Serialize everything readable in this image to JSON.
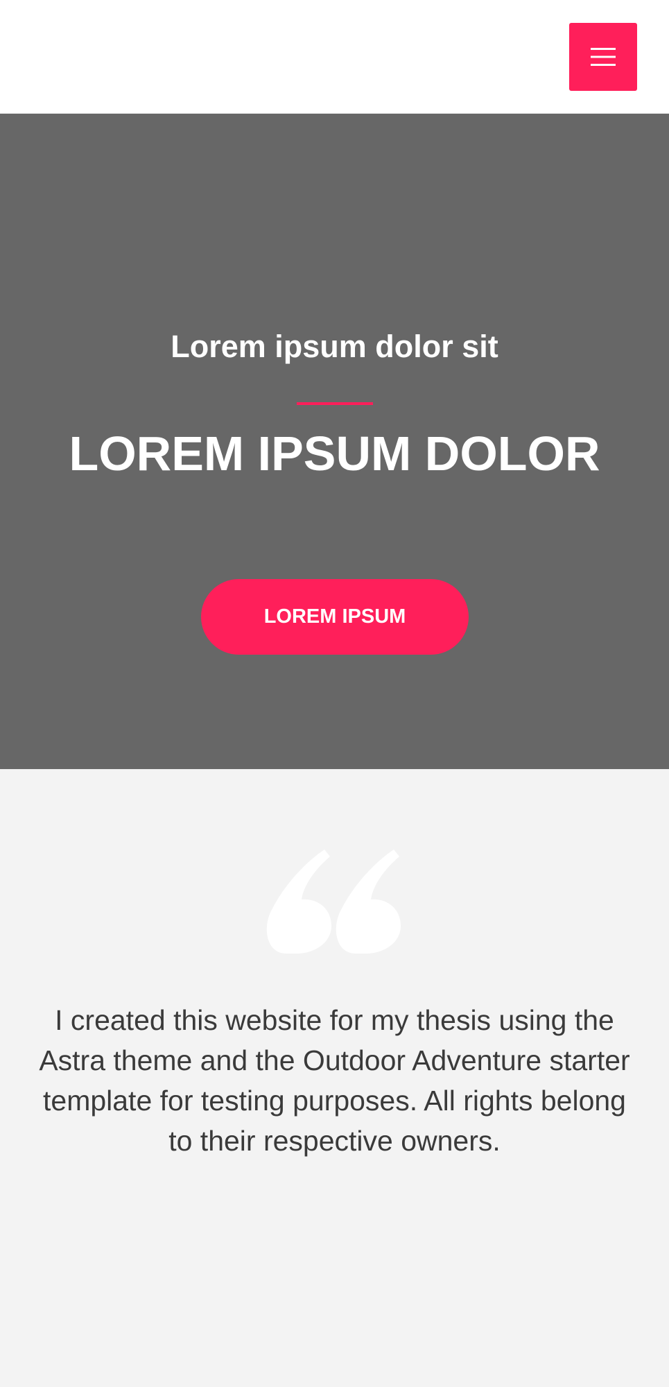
{
  "header": {
    "menu_icon": "hamburger-menu-icon",
    "accent_color": "#ff1f5a"
  },
  "hero": {
    "subtitle": "Lorem ipsum dolor sit",
    "title": "LOREM IPSUM DOLOR",
    "cta_label": "LOREM IPSUM",
    "background_color": "#676767",
    "accent_color": "#ff1f5a"
  },
  "testimonial": {
    "icon": "quote-icon",
    "text": "I created this website for my thesis using the Astra theme and the Outdoor Adventure starter template for testing purposes. All rights belong to their respective owners.",
    "background_color": "#f3f3f3"
  }
}
